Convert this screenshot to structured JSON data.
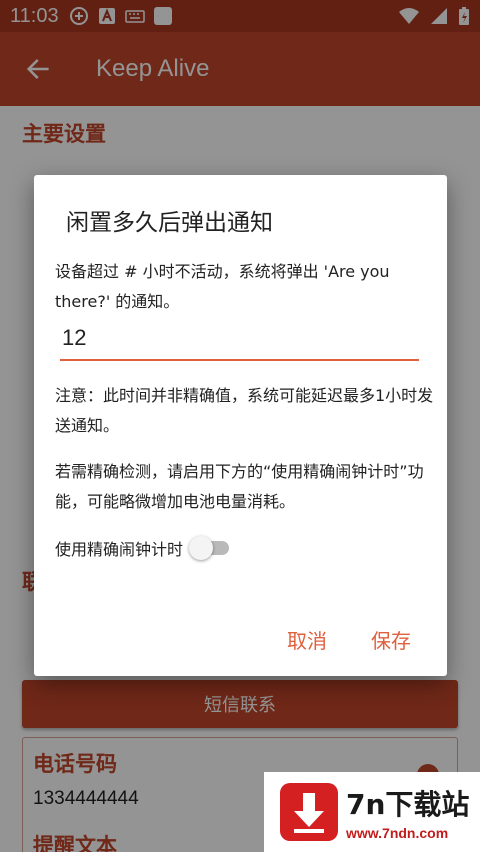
{
  "status_bar": {
    "time": "11:03"
  },
  "app_bar": {
    "title": "Keep Alive"
  },
  "page": {
    "section_title": "主要设置",
    "partial_section_letter": "联",
    "sms_button_label": "短信联系",
    "phone_label": "电话号码",
    "phone_value": "1334444444",
    "reminder_label": "提醒文本"
  },
  "dialog": {
    "title": "闲置多久后弹出通知",
    "body": "设备超过 # 小时不活动，系统将弹出 'Are you there?' 的通知。",
    "input_value": "12",
    "note": "注意：此时间并非精确值，系统可能延迟最多1小时发送通知。",
    "precise_hint": "若需精确检测，请启用下方的“使用精确闹钟计时”功能，可能略微增加电池电量消耗。",
    "toggle_label": "使用精确闹钟计时",
    "toggle_on": false,
    "cancel_label": "取消",
    "save_label": "保存"
  },
  "watermark": {
    "name": "7n下载站",
    "url": "www.7ndn.com"
  },
  "colors": {
    "primary": "#c1452a",
    "status_bar": "#a8381f",
    "accent": "#e0603e"
  },
  "icons": [
    "back-arrow-icon",
    "wifi-icon",
    "signal-icon",
    "battery-icon",
    "download-logo-icon"
  ]
}
